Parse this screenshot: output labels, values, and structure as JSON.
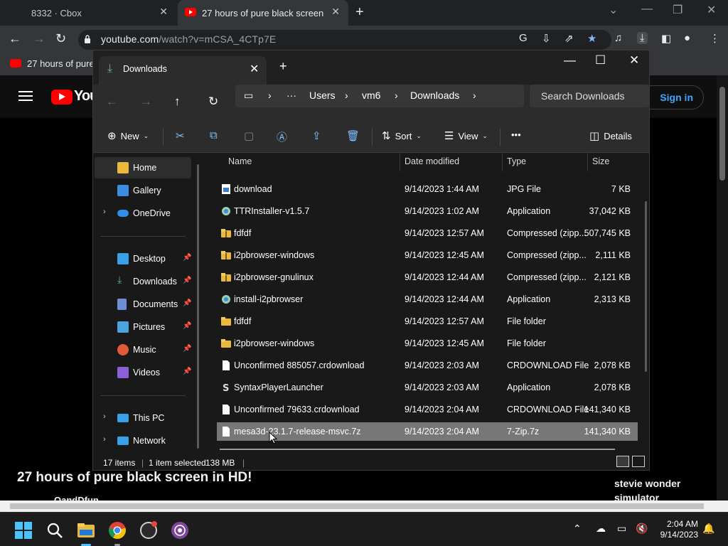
{
  "browser": {
    "tabs": [
      {
        "title": "8332 · Cbox"
      },
      {
        "title": "27 hours of pure black screen in"
      }
    ],
    "new_tab": "+",
    "controls": {
      "minimize": "—",
      "restore": "❐",
      "close": "✕",
      "tablist": "⌄"
    },
    "url": {
      "host": "youtube.com",
      "path": "/watch?v=mCSA_4CTp7E"
    },
    "bookmark": {
      "label": "27 hours of pure"
    }
  },
  "youtube": {
    "logo_text": "You",
    "sign_in": "Sign in",
    "video_title": "27 hours of pure black screen in HD!",
    "channel": "OandDfun",
    "side_video": "stevie wonder simulator"
  },
  "explorer": {
    "tab_label": "Downloads",
    "new_tab": "+",
    "window_controls": {
      "minimize": "—",
      "maximize": "☐",
      "close": "✕"
    },
    "breadcrumbs": [
      "Users",
      "vm6",
      "Downloads"
    ],
    "search_placeholder": "Search Downloads",
    "command_bar": {
      "new": "New",
      "sort": "Sort",
      "view": "View",
      "more": "•••",
      "details": "Details"
    },
    "columns": {
      "name": "Name",
      "date": "Date modified",
      "type": "Type",
      "size": "Size"
    },
    "sidebar": [
      {
        "label": "Home",
        "icon": "home-icon",
        "selected": true
      },
      {
        "label": "Gallery",
        "icon": "gallery-icon"
      },
      {
        "label": "OneDrive",
        "icon": "cloud-icon",
        "expandable": true
      },
      {
        "label": "Desktop",
        "icon": "desktop-icon",
        "pinned": true
      },
      {
        "label": "Downloads",
        "icon": "download-icon",
        "pinned": true
      },
      {
        "label": "Documents",
        "icon": "document-icon",
        "pinned": true
      },
      {
        "label": "Pictures",
        "icon": "pictures-icon",
        "pinned": true
      },
      {
        "label": "Music",
        "icon": "music-icon",
        "pinned": true
      },
      {
        "label": "Videos",
        "icon": "video-icon",
        "pinned": true
      },
      {
        "label": "This PC",
        "icon": "computer-icon",
        "expandable": true
      },
      {
        "label": "Network",
        "icon": "network-icon",
        "expandable": true
      }
    ],
    "files": [
      {
        "name": "download",
        "date": "9/14/2023 1:44 AM",
        "type": "JPG File",
        "size": "7 KB",
        "icon": "image-file-icon"
      },
      {
        "name": "TTRInstaller-v1.5.7",
        "date": "9/14/2023 1:02 AM",
        "type": "Application",
        "size": "37,042 KB",
        "icon": "installer-icon"
      },
      {
        "name": "fdfdf",
        "date": "9/14/2023 12:57 AM",
        "type": "Compressed (zipp...",
        "size": "507,745 KB",
        "icon": "zip-folder-icon"
      },
      {
        "name": "i2pbrowser-windows",
        "date": "9/14/2023 12:45 AM",
        "type": "Compressed (zipp...",
        "size": "2,111 KB",
        "icon": "zip-folder-icon"
      },
      {
        "name": "i2pbrowser-gnulinux",
        "date": "9/14/2023 12:44 AM",
        "type": "Compressed (zipp...",
        "size": "2,121 KB",
        "icon": "zip-folder-icon"
      },
      {
        "name": "install-i2pbrowser",
        "date": "9/14/2023 12:44 AM",
        "type": "Application",
        "size": "2,313 KB",
        "icon": "installer-icon"
      },
      {
        "name": "fdfdf",
        "date": "9/14/2023 12:57 AM",
        "type": "File folder",
        "size": "",
        "icon": "folder-icon"
      },
      {
        "name": "i2pbrowser-windows",
        "date": "9/14/2023 12:45 AM",
        "type": "File folder",
        "size": "",
        "icon": "folder-icon"
      },
      {
        "name": "Unconfirmed 885057.crdownload",
        "date": "9/14/2023 2:03 AM",
        "type": "CRDOWNLOAD File",
        "size": "2,078 KB",
        "icon": "file-icon"
      },
      {
        "name": "SyntaxPlayerLauncher",
        "date": "9/14/2023 2:03 AM",
        "type": "Application",
        "size": "2,078 KB",
        "icon": "app-s-icon"
      },
      {
        "name": "Unconfirmed 79633.crdownload",
        "date": "9/14/2023 2:04 AM",
        "type": "CRDOWNLOAD File",
        "size": "141,340 KB",
        "icon": "file-icon"
      },
      {
        "name": "mesa3d-23.1.7-release-msvc.7z",
        "date": "9/14/2023 2:04 AM",
        "type": "7-Zip.7z",
        "size": "141,340 KB",
        "icon": "file-icon",
        "selected": true
      }
    ],
    "status": {
      "items": "17 items",
      "selected": "1 item selected",
      "size": "138 MB"
    }
  },
  "taskbar": {
    "clock_time": "2:04 AM",
    "clock_date": "9/14/2023"
  },
  "colors": {
    "accent": "#7fc2ff",
    "yt_red": "#ff0000",
    "folder": "#e8b93c",
    "selection": "#777777"
  }
}
